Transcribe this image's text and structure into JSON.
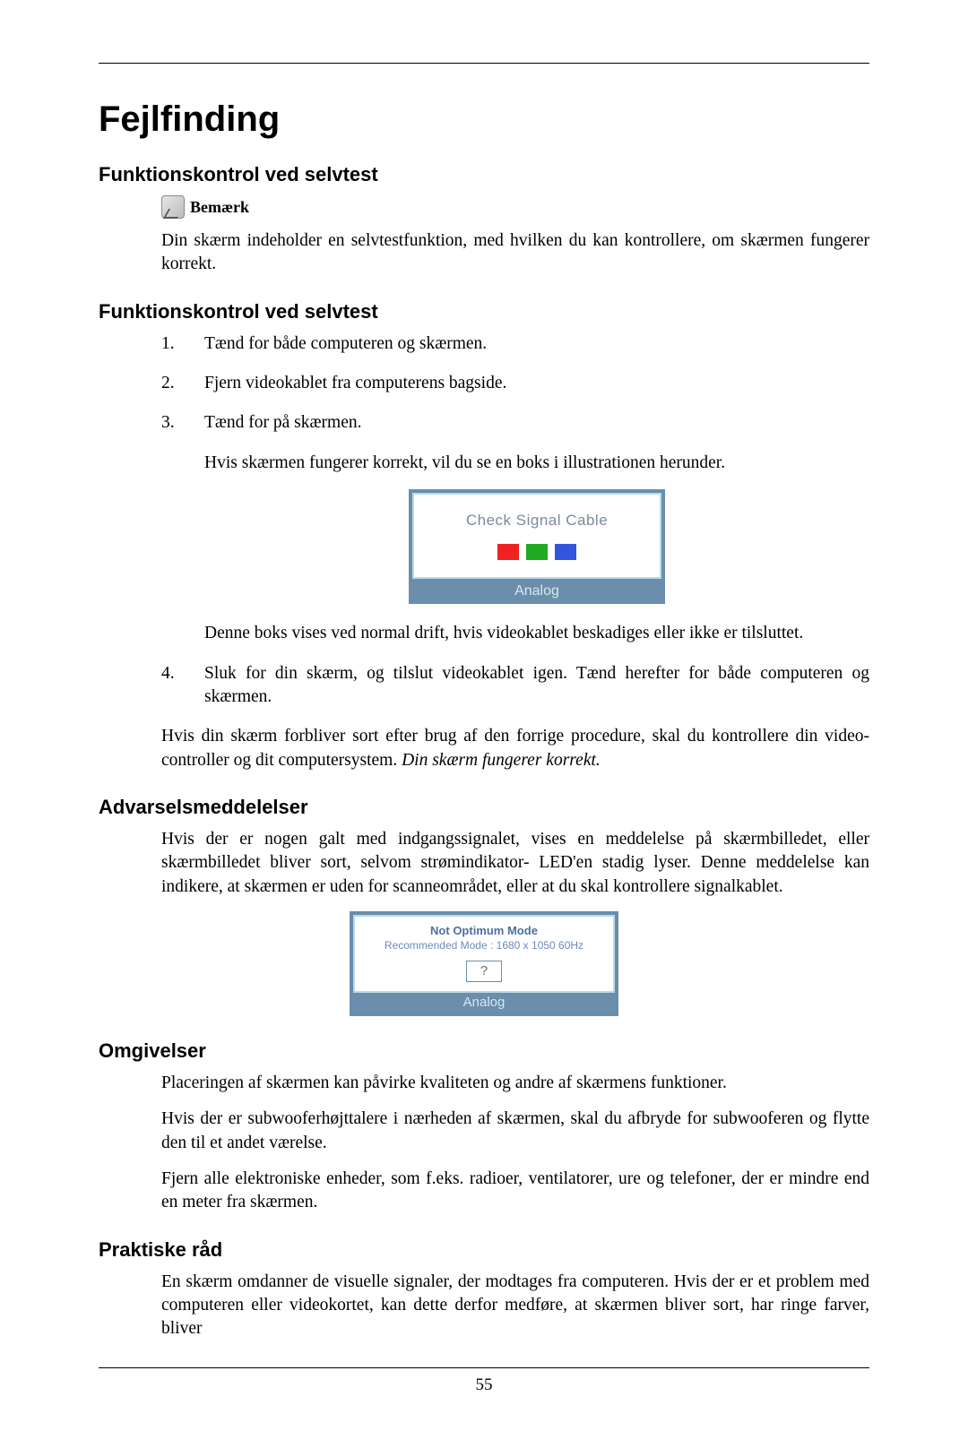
{
  "page_number": "55",
  "title": "Fejlfinding",
  "s1": {
    "heading": "Funktionskontrol ved selvtest",
    "note_label": "Bemærk",
    "p1": "Din skærm indeholder en selvtestfunktion, med hvilken du kan kontrollere, om skærmen fungerer korrekt."
  },
  "s2": {
    "heading": "Funktionskontrol ved selvtest",
    "li1": "Tænd for både computeren og skærmen.",
    "li2": "Fjern videokablet fra computerens bagside.",
    "li3": "Tænd for på skærmen.",
    "li3_sub1": "Hvis skærmen fungerer korrekt, vil du se en boks i illustrationen herunder.",
    "li3_sub2": "Denne boks vises ved normal drift, hvis videokablet beskadiges eller ikke er tilsluttet.",
    "li4": "Sluk for din skærm, og tilslut videokablet igen. Tænd herefter for både computeren og skærmen.",
    "p_after_a": "Hvis din skærm forbliver sort efter brug af den forrige procedure, skal du kontrollere din video-controller og dit computersystem. ",
    "p_after_b": "Din skærm fungerer korrekt."
  },
  "osd1": {
    "msg": "Check Signal Cable",
    "bar": "Analog"
  },
  "s3": {
    "heading": "Advarselsmeddelelser",
    "p1": "Hvis der er nogen galt med indgangssignalet, vises en meddelelse på skærmbilledet, eller skærmbilledet bliver sort, selvom strømindikator- LED'en stadig lyser. Denne meddelelse kan indikere, at skærmen er uden for scanneområdet, eller at du skal kontrollere signalkablet."
  },
  "osd2": {
    "h1": "Not Optimum Mode",
    "h2": "Recommended Mode : 1680 x 1050 60Hz",
    "q": "?",
    "bar": "Analog"
  },
  "s4": {
    "heading": "Omgivelser",
    "p1": "Placeringen af skærmen kan påvirke kvaliteten og andre af skærmens funktioner.",
    "p2": "Hvis der er subwooferhøjttalere i nærheden af skærmen, skal du afbryde for subwooferen og flytte den til et andet værelse.",
    "p3": "Fjern alle elektroniske enheder, som f.eks. radioer, ventilatorer, ure og telefoner, der er mindre end en meter fra skærmen."
  },
  "s5": {
    "heading": "Praktiske råd",
    "p1": "En skærm omdanner de visuelle signaler, der modtages fra computeren. Hvis der er et problem med computeren eller videokortet, kan dette derfor medføre, at skærmen bliver sort, har ringe farver, bliver"
  }
}
